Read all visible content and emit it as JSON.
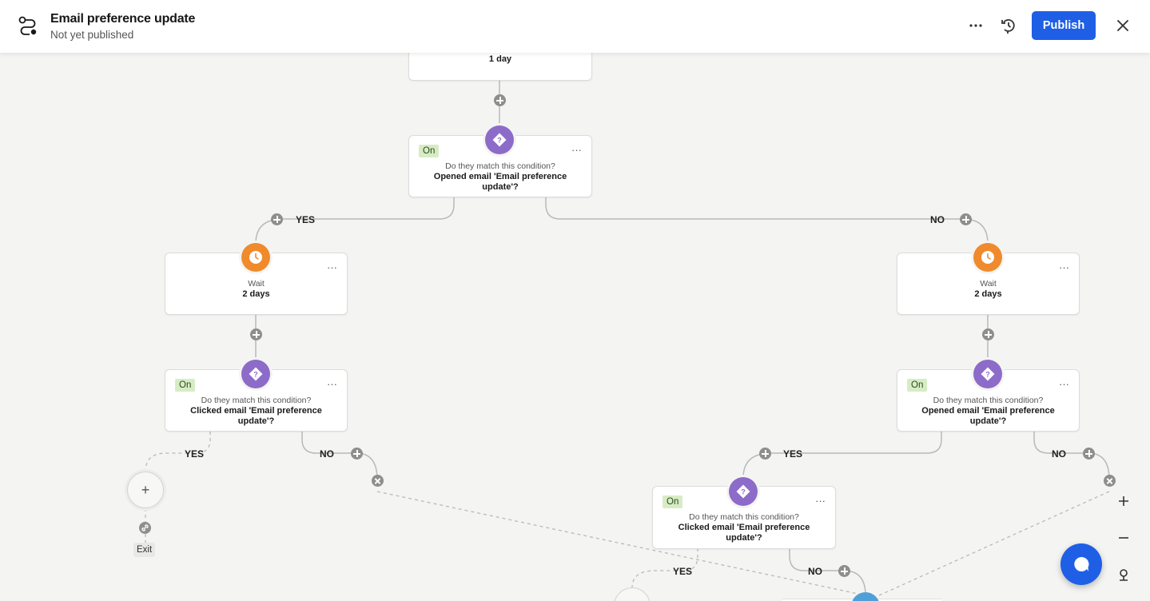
{
  "header": {
    "title": "Email preference update",
    "subtitle": "Not yet published",
    "publish_label": "Publish",
    "more_label": "···"
  },
  "colors": {
    "accent": "#1f5fe6",
    "condition": "#8d6bc9",
    "wait": "#ef8b2c",
    "on_badge": "#d7ecc5"
  },
  "icons": [
    "flow-icon",
    "more-icon",
    "history-icon",
    "close-icon",
    "question-diamond-icon",
    "clock-icon",
    "plus-icon",
    "x-icon",
    "link-icon",
    "zoom-in-icon",
    "zoom-out-icon",
    "recenter-icon",
    "chat-icon"
  ],
  "nodes": {
    "top_wait": {
      "value": "1 day"
    },
    "cond_root": {
      "badge": "On",
      "question": "Do they match this condition?",
      "condition": "Opened email 'Email preference update'?"
    },
    "wait_left": {
      "label": "Wait",
      "value": "2 days"
    },
    "wait_right": {
      "label": "Wait",
      "value": "2 days"
    },
    "cond_left": {
      "badge": "On",
      "question": "Do they match this condition?",
      "condition": "Clicked email 'Email preference update'?"
    },
    "cond_right": {
      "badge": "On",
      "question": "Do they match this condition?",
      "condition": "Opened email 'Email preference update'?"
    },
    "cond_mid": {
      "badge": "On",
      "question": "Do they match this condition?",
      "condition": "Clicked email 'Email preference update'?"
    }
  },
  "branches": {
    "yes": "YES",
    "no": "NO"
  },
  "exit": {
    "label": "Exit",
    "add": "+"
  },
  "card_menu": "···"
}
